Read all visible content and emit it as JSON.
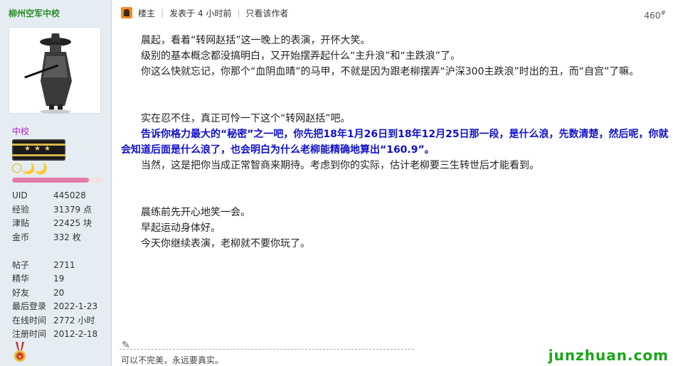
{
  "user": {
    "name": "柳州空军中校",
    "rank": "中校",
    "moons": "🌕🌙🌙",
    "level_progress_percent": 84,
    "stats": [
      {
        "k": "UID",
        "v": "445028"
      },
      {
        "k": "经验",
        "v": "31379 点"
      },
      {
        "k": "津贴",
        "v": "22425 块"
      },
      {
        "k": "金币",
        "v": "332 枚"
      }
    ],
    "stats2": [
      {
        "k": "帖子",
        "v": "2711"
      },
      {
        "k": "精华",
        "v": "19"
      },
      {
        "k": "好友",
        "v": "20"
      },
      {
        "k": "最后登录",
        "v": "2022-1-23"
      },
      {
        "k": "在线时间",
        "v": "2772 小时"
      },
      {
        "k": "注册时间",
        "v": "2012-2-18"
      }
    ]
  },
  "header": {
    "author_tag": "楼主",
    "posted": "发表于 4 小时前",
    "only_author": "只看该作者",
    "floor": "460",
    "floor_sup": "#"
  },
  "post": {
    "lines": [
      "晨起，看着“转网赵括”这一晚上的表演，开怀大笑。",
      "级别的基本概念都没搞明白，又开始摆弄起什么“主升浪”和“主跌浪”了。",
      "你这么快就忘记，你那个“血阴血晴”的马甲，不就是因为跟老柳摆弄“沪深300主跌浪”时出的丑，而“自宫”了嘛。"
    ],
    "line4": "实在忍不住，真正可怜一下这个“转网赵括”吧。",
    "bold": "告诉你格力最大的“秘密”之一吧，你先把18年1月26日到18年12月25日那一段，是什么浪，先数清楚，然后呢，你就会知道后面是什么浪了，也会明白为什么老柳能精确地算出“160.9”。",
    "line6": "当然，这是把你当成正常智商来期待。考虑到你的实际，估计老柳要三生转世后才能看到。",
    "tail": [
      "晨练前先开心地笑一会。",
      "早起运动身体好。",
      "今天你继续表演，老柳就不要你玩了。"
    ]
  },
  "signature": "可以不完美，永远要真实。",
  "watermark": "junzhuan.com",
  "colors": {
    "username": "#2a8d2a",
    "rank": "#b21ac5",
    "bold_text": "#1010cc",
    "watermark": "#1aa61a"
  }
}
